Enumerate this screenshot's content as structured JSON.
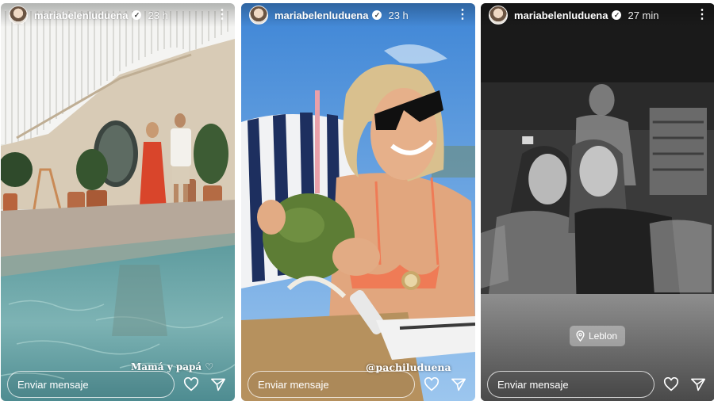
{
  "stories": [
    {
      "username": "mariabelenluduena",
      "time": "23 h",
      "caption": "Mamá y papá ♡",
      "reply_placeholder": "Enviar mensaje"
    },
    {
      "username": "mariabelenluduena",
      "time": "23 h",
      "mention": "@pachiluduena",
      "reply_placeholder": "Enviar mensaje"
    },
    {
      "username": "mariabelenluduena",
      "time": "27 min",
      "location": "Leblon",
      "reply_placeholder": "Enviar mensaje"
    }
  ],
  "icons": {
    "verified": "verified-badge-icon",
    "more": "more-options-icon",
    "like": "heart-icon",
    "share": "send-icon",
    "location": "map-pin-icon"
  },
  "colors": {
    "ui_text": "#ffffff",
    "pool_water": "#6ea6a8",
    "sky": "#4a90d8",
    "bw_background": "#1c1c1c"
  }
}
